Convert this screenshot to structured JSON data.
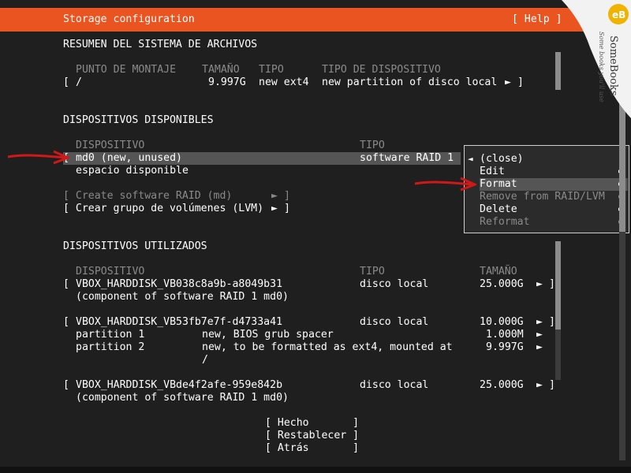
{
  "header": {
    "title": "Storage configuration",
    "help": "[ Help ]"
  },
  "filesystem_summary": {
    "heading": "RESUMEN DEL SISTEMA DE ARCHIVOS",
    "columns": [
      "PUNTO DE MONTAJE",
      "TAMAÑO",
      "TIPO",
      "TIPO DE DISPOSITIVO"
    ],
    "rows": [
      {
        "open": "[",
        "mount": "/",
        "size": "9.997G",
        "type": "new ext4",
        "device_type": "new partition of disco local",
        "arrow": "►",
        "close": "]"
      }
    ]
  },
  "available": {
    "heading": "DISPOSITIVOS DISPONIBLES",
    "columns": [
      "DISPOSITIVO",
      "TIPO"
    ],
    "selected_open": "[",
    "selected_device": "md0 (new, unused)",
    "selected_type": "software RAID 1",
    "free_space": "espacio disponible",
    "create_raid": "[ Create software RAID (md)",
    "create_raid_arrow": "►",
    "create_raid_close": "]",
    "create_lvm": "[ Crear grupo de volúmenes (LVM)",
    "create_lvm_arrow": "►",
    "create_lvm_close": "]"
  },
  "context_menu": {
    "caret": "◄",
    "items": [
      {
        "label": "(close)",
        "arrow": "",
        "enabled": true
      },
      {
        "label": "Edit",
        "arrow": "►",
        "enabled": true
      },
      {
        "label": "Format",
        "arrow": "►",
        "enabled": true,
        "selected": true
      },
      {
        "label": "Remove from RAID/LVM",
        "arrow": "►",
        "enabled": false
      },
      {
        "label": "Delete",
        "arrow": "►",
        "enabled": true
      },
      {
        "label": "Reformat",
        "arrow": "►",
        "enabled": false
      }
    ]
  },
  "used": {
    "heading": "DISPOSITIVOS UTILIZADOS",
    "columns": [
      "DISPOSITIVO",
      "TIPO",
      "TAMAÑO"
    ],
    "disks": [
      {
        "open": "[",
        "name": "VBOX_HARDDISK_VB038c8a9b-a8049b31",
        "type": "disco local",
        "size": "25.000G",
        "arrow": "►",
        "close": "]",
        "sub": "(component of software RAID 1 md0)"
      },
      {
        "open": "[",
        "name": "VBOX_HARDDISK_VB53fb7e7f-d4733a41",
        "type": "disco local",
        "size": "10.000G",
        "arrow": "►",
        "close": "]",
        "partitions": [
          {
            "name": "partition 1",
            "desc": "new, BIOS grub spacer",
            "size": "1.000M",
            "arrow": "►"
          },
          {
            "name": "partition 2",
            "desc": "new, to be formatted as ext4, mounted at",
            "desc2": "/",
            "size": "9.997G",
            "arrow": "►"
          }
        ]
      },
      {
        "open": "[",
        "name": "VBOX_HARDDISK_VBde4f2afe-959e842b",
        "type": "disco local",
        "size": "25.000G",
        "arrow": "►",
        "close": "]",
        "sub": "(component of software RAID 1 md0)"
      }
    ]
  },
  "buttons": {
    "done": "[ Hecho       ]",
    "reset": "[ Restablecer ]",
    "back": "[ Atrás       ]"
  },
  "logo": {
    "letters": "eB",
    "name": "SomeBooks",
    "slogan": "Some books you'll use"
  },
  "colors": {
    "accent": "#e95420",
    "background": "#1f1f1f",
    "highlight": "#555555",
    "annotation": "#d01818"
  }
}
